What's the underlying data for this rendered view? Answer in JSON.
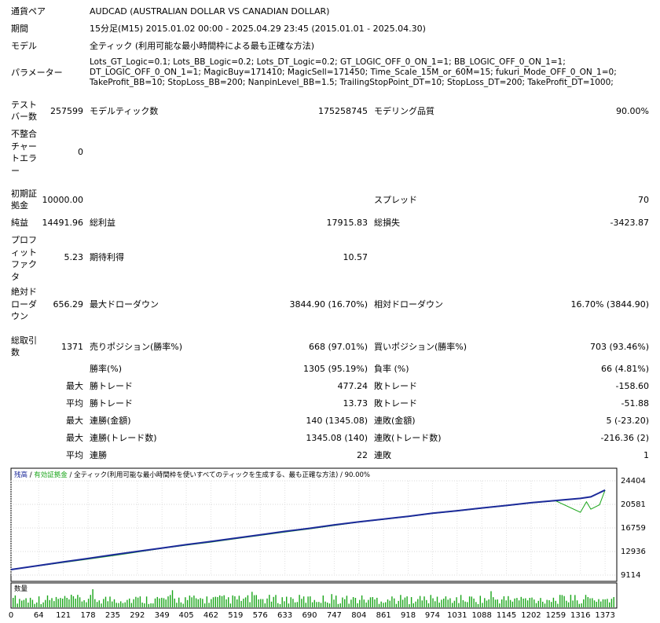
{
  "report": {
    "symbol_label": "通貨ペア",
    "symbol_value": "AUDCAD (AUSTRALIAN DOLLAR VS CANADIAN DOLLAR)",
    "period_label": "期間",
    "period_value": "15分足(M15) 2015.01.02 00:00 - 2025.04.29 23:45 (2015.01.01 - 2025.04.30)",
    "model_label": "モデル",
    "model_value": "全ティック (利用可能な最小時間枠による最も正確な方法)",
    "params_label": "パラメーター",
    "params_value": "Lots_GT_Logic=0.1; Lots_BB_Logic=0.2; Lots_DT_Logic=0.2; GT_LOGIC_OFF_0_ON_1=1; BB_LOGIC_OFF_0_ON_1=1; DT_LOGIC_OFF_0_ON_1=1; MagicBuy=171410; MagicSell=171450; Time_Scale_15M_or_60M=15; fukuri_Mode_OFF_0_ON_1=0; TakeProfit_BB=10; StopLoss_BB=200; NanpinLevel_BB=1.5; TrailingStopPoint_DT=10; StopLoss_DT=200; TakeProfit_DT=1000;",
    "bars_label": "テスト\nバー数",
    "bars_value": "257599",
    "ticks_label": "モデルティック数",
    "ticks_value": "175258745",
    "quality_label": "モデリング品質",
    "quality_value": "90.00%",
    "mismatch_label": "不整合\nチャー\nトエラ\nー",
    "mismatch_value": "0",
    "deposit_label": "初期証\n拠金",
    "deposit_value": "10000.00",
    "spread_label": "スプレッド",
    "spread_value": "70",
    "net_label": "純益",
    "net_value": "14491.96",
    "gross_profit_label": "総利益",
    "gross_profit_value": "17915.83",
    "gross_loss_label": "総損失",
    "gross_loss_value": "-3423.87",
    "pf_label": "プロフ\nィット\nファク\nタ",
    "pf_value": "5.23",
    "expected_label": "期待利得",
    "expected_value": "10.57",
    "abs_dd_label": "絶対ド\nローダ\nウン",
    "abs_dd_value": "656.29",
    "max_dd_label": "最大ドローダウン",
    "max_dd_value": "3844.90 (16.70%)",
    "rel_dd_label": "相対ドローダウン",
    "rel_dd_value": "16.70% (3844.90)",
    "total_label": "総取引\n数",
    "total_value": "1371",
    "short_label": "売りポジション(勝率%)",
    "short_value": "668 (97.01%)",
    "long_label": "買いポジション(勝率%)",
    "long_value": "703 (93.46%)",
    "win_rate_label": "勝率(%)",
    "win_rate_value": "1305 (95.19%)",
    "loss_rate_label": "負率 (%)",
    "loss_rate_value": "66 (4.81%)",
    "max_label": "最大",
    "largest_win_label": "勝トレード",
    "largest_win_value": "477.24",
    "largest_loss_label": "敗トレード",
    "largest_loss_value": "-158.60",
    "avg_label": "平均",
    "avg_win_label": "勝トレード",
    "avg_win_value": "13.73",
    "avg_loss_label": "敗トレード",
    "avg_loss_value": "-51.88",
    "max2_label": "最大",
    "cons_win_amt_label": "連勝(金額)",
    "cons_win_amt_value": "140 (1345.08)",
    "cons_loss_amt_label": "連敗(金額)",
    "cons_loss_amt_value": "5 (-23.20)",
    "max3_label": "最大",
    "cons_win_cnt_label": "連勝(トレード数)",
    "cons_win_cnt_value": "1345.08 (140)",
    "cons_loss_cnt_label": "連敗(トレード数)",
    "cons_loss_cnt_value": "-216.36 (2)",
    "avg2_label": "平均",
    "avg_cons_win_label": "連勝",
    "avg_cons_win_value": "22",
    "avg_cons_loss_label": "連敗",
    "avg_cons_loss_value": "1"
  },
  "chart_header": {
    "balance": "残高",
    "sep1": " / ",
    "equity": "有効証拠金",
    "sep2": " / ",
    "model_desc": "全ティック(利用可能な最小時間枠を使いすべてのティックを生成する、最も正確な方法)",
    "sep3": " / ",
    "quality": "90.00%"
  },
  "colors": {
    "balance": "#1c2a9a",
    "equity": "#1aa51a",
    "volume": "#1aa51a"
  },
  "chart_data": [
    {
      "type": "line",
      "series": [
        {
          "name": "残高",
          "x": [
            0,
            64,
            121,
            178,
            235,
            292,
            349,
            405,
            462,
            519,
            576,
            633,
            690,
            747,
            804,
            861,
            918,
            974,
            1031,
            1088,
            1145,
            1202,
            1259,
            1316,
            1340,
            1373
          ],
          "y": [
            10000,
            10650,
            11250,
            11800,
            12400,
            12950,
            13500,
            14050,
            14550,
            15100,
            15650,
            16200,
            16700,
            17250,
            17750,
            18200,
            18650,
            19150,
            19550,
            20000,
            20400,
            20850,
            21200,
            21550,
            21800,
            22900
          ]
        },
        {
          "name": "有効証拠金",
          "x": [
            0,
            64,
            121,
            178,
            235,
            292,
            349,
            405,
            462,
            519,
            576,
            633,
            690,
            747,
            804,
            861,
            918,
            974,
            1031,
            1088,
            1145,
            1202,
            1259,
            1316,
            1330,
            1340,
            1360,
            1373
          ],
          "y": [
            10000,
            10600,
            11150,
            11700,
            12250,
            12850,
            13450,
            13950,
            14450,
            15000,
            15550,
            16100,
            16600,
            17150,
            17700,
            18150,
            18600,
            19100,
            19500,
            19950,
            20350,
            20800,
            21150,
            19300,
            21000,
            19800,
            20500,
            22900
          ]
        }
      ],
      "y_ticks": [
        "24404",
        "20581",
        "16759",
        "12936",
        "9114"
      ],
      "ylim": [
        9114,
        24404
      ],
      "xlim": [
        0,
        1400
      ],
      "grid": true
    },
    {
      "type": "bar",
      "title": "数量",
      "x_ticks": [
        "0",
        "64",
        "121",
        "178",
        "235",
        "292",
        "349",
        "405",
        "462",
        "519",
        "576",
        "633",
        "690",
        "747",
        "804",
        "861",
        "918",
        "974",
        "1031",
        "1088",
        "1145",
        "1202",
        "1259",
        "1316",
        "1373"
      ]
    }
  ]
}
